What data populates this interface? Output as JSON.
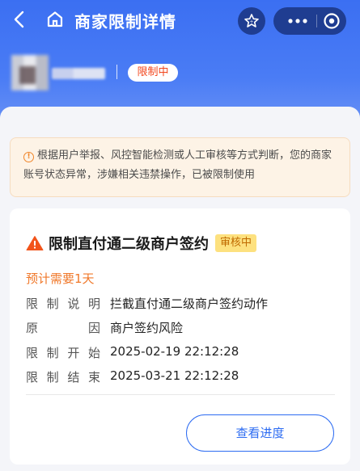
{
  "header": {
    "title": "商家限制详情",
    "status_pill": "限制中"
  },
  "notice": {
    "text": "根据用户举报、风控智能检测或人工审核等方式判断，您的商家账号状态异常，涉嫌相关违禁操作，已被限制使用"
  },
  "restriction": {
    "title": "限制直付通二级商户签约",
    "badge": "审核中",
    "estimate": "预计需要1天",
    "rows": [
      {
        "label": [
          "限",
          "制",
          "说",
          "明"
        ],
        "value": "拦截直付通二级商户签约动作"
      },
      {
        "label": [
          "原",
          "因"
        ],
        "value": "商户签约风险"
      },
      {
        "label": [
          "限",
          "制",
          "开",
          "始"
        ],
        "value": "2025-02-19 22:12:28"
      },
      {
        "label": [
          "限",
          "制",
          "结",
          "束"
        ],
        "value": "2025-03-21 22:12:28"
      }
    ],
    "button": "查看进度"
  },
  "colors": {
    "primary": "#3b6ff2",
    "warning_orange": "#f0782a",
    "danger_red": "#f2451c",
    "badge_yellow": "#fde17f"
  },
  "icons": [
    "back-icon",
    "home-icon",
    "star-icon",
    "more-icon",
    "target-icon",
    "info-icon",
    "warning-triangle-icon"
  ]
}
